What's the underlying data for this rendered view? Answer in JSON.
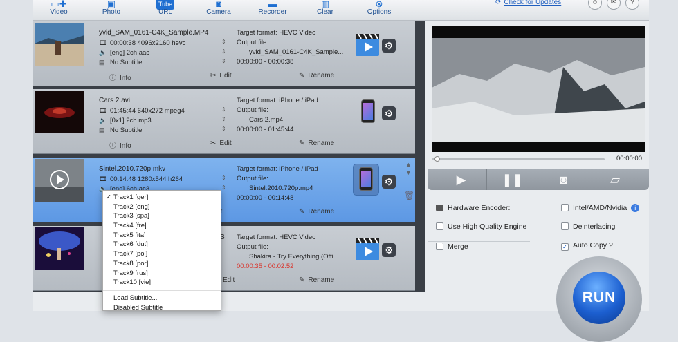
{
  "toolbar": {
    "buttons": [
      {
        "label": "Video",
        "icon": "add-video-icon"
      },
      {
        "label": "Photo",
        "icon": "photo-icon"
      },
      {
        "label": "URL",
        "icon": "youtube-icon"
      },
      {
        "label": "Camera",
        "icon": "camera-icon"
      },
      {
        "label": "Recorder",
        "icon": "screen-recorder-icon"
      },
      {
        "label": "Clear",
        "icon": "trash-icon"
      },
      {
        "label": "Options",
        "icon": "options-icon"
      }
    ],
    "check_updates": "Check for Updates"
  },
  "items": [
    {
      "filename": "yvid_SAM_0161-C4K_Sample.MP4",
      "video": "00:00:38 4096x2160 hevc",
      "audio": "[eng] 2ch aac",
      "subtitle": "No Subtitle",
      "target_format": "Target format: HEVC Video",
      "output_label": "Output file:",
      "output_file": "yvid_SAM_0161-C4K_Sample...",
      "range_start": "00:00:00",
      "range_sep": " - ",
      "range_end": "00:00:38",
      "device_icon": "hevc-video-icon"
    },
    {
      "filename": "Cars 2.avi",
      "video": "01:45:44 640x272 mpeg4",
      "audio": "[0x1] 2ch mp3",
      "subtitle": "No Subtitle",
      "target_format": "Target format: iPhone / iPad",
      "output_label": "Output file:",
      "output_file": "Cars 2.mp4",
      "range_start": "00:00:00",
      "range_sep": " - ",
      "range_end": "01:45:44",
      "device_icon": "iphone-icon"
    },
    {
      "filename": "Sintel.2010.720p.mkv",
      "video": "00:14:48 1280x544 h264",
      "audio": "[eng] 6ch ac3",
      "subtitle": "",
      "target_format": "Target format: iPhone / iPad",
      "output_label": "Output file:",
      "output_file": "Sintel.2010.720p.mp4",
      "range_start": "00:00:00",
      "range_sep": " - ",
      "range_end": "00:14:48",
      "device_icon": "iphone-icon"
    },
    {
      "filename": "",
      "video": "",
      "audio": "",
      "subtitle": "",
      "target_format": "Target format: HEVC Video",
      "output_label": "Output file:",
      "output_file": "Shakira - Try Everything (Offi...",
      "range_start": "00:00:35",
      "range_sep": " - ",
      "range_end": "00:02:52",
      "device_icon": "hevc-video-icon"
    }
  ],
  "actions": {
    "info": "Info",
    "edit": "Edit",
    "rename": "Rename"
  },
  "subtitle_menu": {
    "items": [
      "Track1 [ger]",
      "Track2 [eng]",
      "Track3 [spa]",
      "Track4 [fre]",
      "Track5 [ita]",
      "Track6 [dut]",
      "Track7 [pol]",
      "Track8 [por]",
      "Track9 [rus]",
      "Track10 [vie]"
    ],
    "checked_index": 0,
    "check_mark": "✓",
    "load": "Load Subtitle...",
    "disabled": "Disabled Subtitle"
  },
  "preview": {
    "time": "00:00:00"
  },
  "options": {
    "hardware_encoder": "Hardware Encoder:",
    "intel": "Intel/AMD/Nvidia",
    "high_quality": "Use High Quality Engine",
    "deinterlacing": "Deinterlacing",
    "merge": "Merge",
    "auto_copy": "Auto Copy",
    "auto_copy_checked": true,
    "help": "?"
  },
  "run_label": "RUN",
  "colors": {
    "accent": "#1f6fd1",
    "selected_row": "#6aa6ea",
    "red_time": "#d9332b"
  }
}
